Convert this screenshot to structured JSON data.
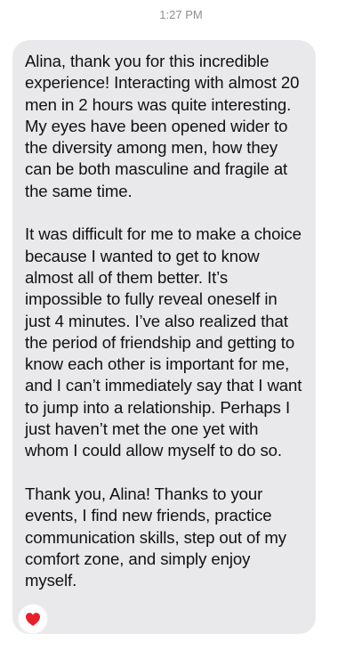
{
  "timestamp": "1:27 PM",
  "message": {
    "paragraphs": [
      "Alina, thank you for this incredible experience! Interacting with almost 20 men in 2 hours was quite interesting. My eyes have been opened wider to the diversity among men, how they can be both masculine and fragile at the same time.",
      "It was difficult for me to make a choice because I wanted to get to know almost all of them better. It’s impossible to fully reveal oneself in just 4 minutes. I’ve also realized that the period of friendship and getting to know each other is important for me, and I can’t immediately say that I want to jump into a relationship. Perhaps I just haven’t met the one yet with whom I could allow myself to do so.",
      "Thank you, Alina! Thanks to your events, I find new friends, practice communication skills, step out of my comfort zone, and simply enjoy myself."
    ],
    "bubble_color": "#e9e9eb"
  },
  "reaction": {
    "icon": "heart-icon",
    "color": "#e8202a"
  }
}
